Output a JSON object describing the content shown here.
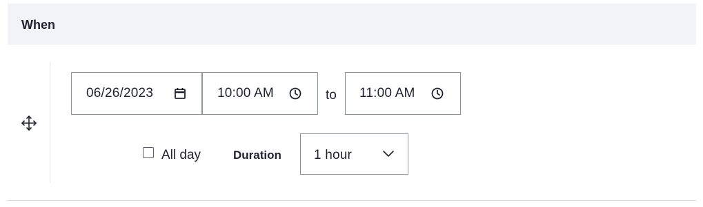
{
  "section": {
    "title": "When"
  },
  "date_field": {
    "value": "06/26/2023",
    "icon": "calendar-icon"
  },
  "start_time": {
    "value": "10:00 AM",
    "icon": "clock-icon"
  },
  "separator": {
    "label": "to"
  },
  "end_time": {
    "value": "11:00 AM",
    "icon": "clock-icon"
  },
  "all_day": {
    "label": "All day",
    "checked": false
  },
  "duration": {
    "label": "Duration",
    "selected": "1 hour",
    "icon": "chevron-down-icon"
  },
  "drag_handle": {
    "icon": "move-icon"
  }
}
